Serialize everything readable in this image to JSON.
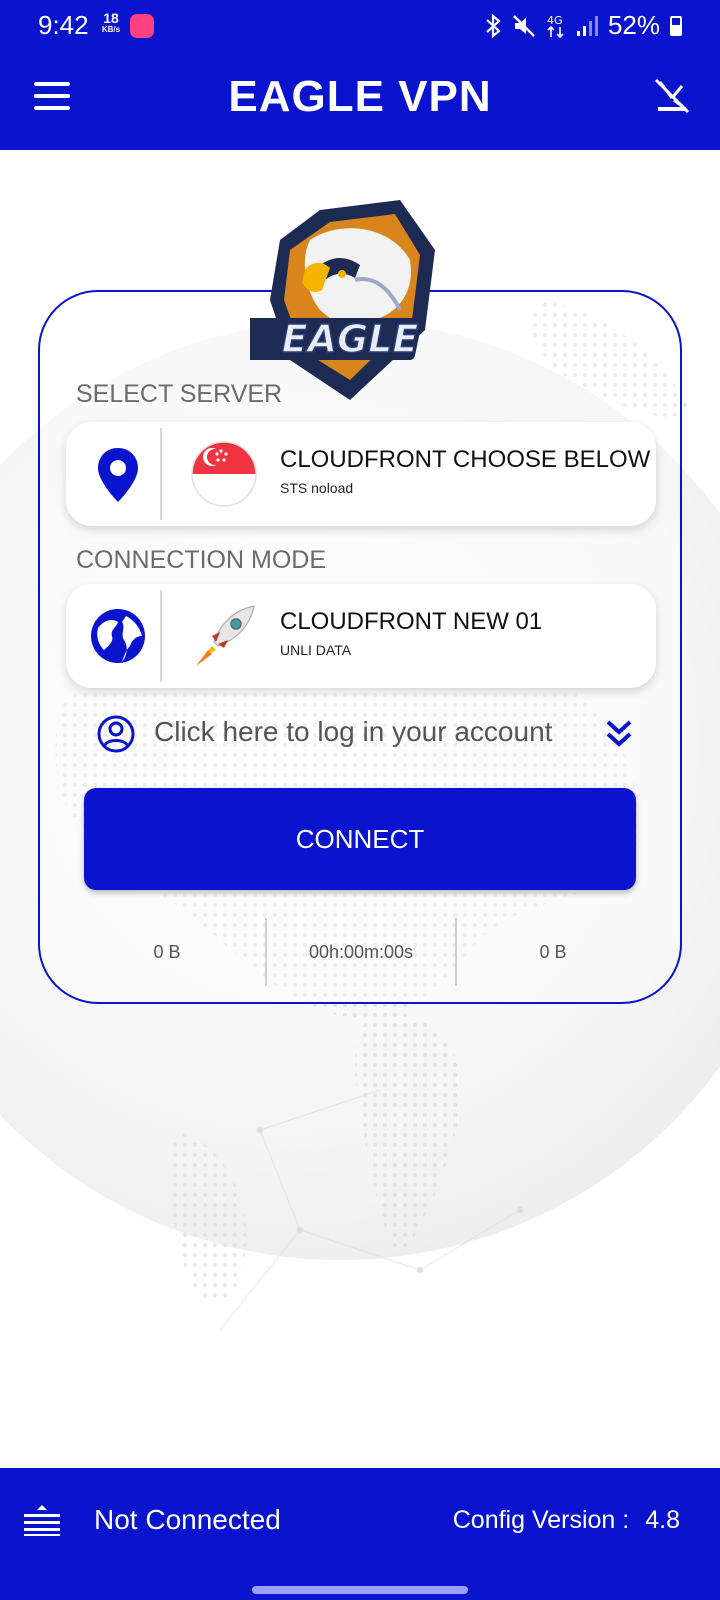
{
  "status_bar": {
    "time": "9:42",
    "speed_value": "18",
    "speed_unit": "KB/s",
    "battery": "52%"
  },
  "app_bar": {
    "title": "EAGLE VPN",
    "menu_icon": "hamburger-menu-icon",
    "right_icon": "tools-icon"
  },
  "logo": {
    "text": "EAGLE",
    "icon": "eagle-logo"
  },
  "server": {
    "section_label": "SELECT SERVER",
    "title": "CLOUDFRONT CHOOSE BELOW",
    "subtitle": "STS noload",
    "left_icon": "location-pin-icon",
    "thumb_icon": "singapore-flag-icon"
  },
  "mode": {
    "section_label": "CONNECTION MODE",
    "title": "CLOUDFRONT NEW 01",
    "subtitle": "UNLI DATA",
    "left_icon": "globe-icon",
    "thumb_icon": "rocket-icon"
  },
  "login": {
    "text": "Click here to log in your account",
    "icon": "account-circle-icon",
    "chevron": "double-chevron-down-icon"
  },
  "connect_button": {
    "label": "CONNECT"
  },
  "stats": {
    "download": "0 B",
    "duration": "00h:00m:00s",
    "upload": "0 B"
  },
  "bottom_bar": {
    "status": "Not Connected",
    "config_label": "Config Version :",
    "config_version": "4.8"
  },
  "colors": {
    "primary": "#0a14cc",
    "background": "#ffffff"
  }
}
